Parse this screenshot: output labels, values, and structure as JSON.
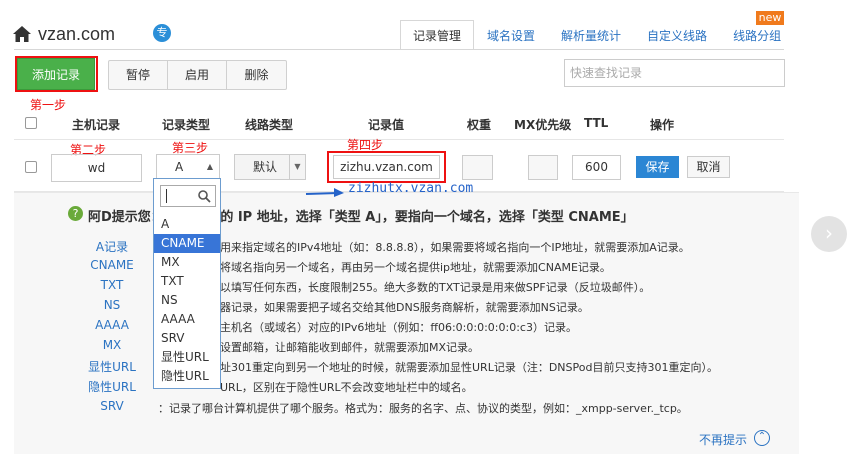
{
  "header": {
    "domain": "vzan.com",
    "badge": "专"
  },
  "tabs": [
    {
      "label": "记录管理",
      "active": true
    },
    {
      "label": "域名设置"
    },
    {
      "label": "解析量统计"
    },
    {
      "label": "自定义线路"
    },
    {
      "label": "线路分组"
    }
  ],
  "new_badge": "new",
  "toolbar": {
    "add_label": "添加记录",
    "pause_label": "暂停",
    "enable_label": "启用",
    "delete_label": "删除",
    "search_placeholder": "快速查找记录"
  },
  "steps": {
    "step1": "第一步",
    "step2": "第二步",
    "step3": "第三步",
    "step4": "第四步"
  },
  "columns": {
    "host": "主机记录",
    "type": "记录类型",
    "line": "线路类型",
    "value": "记录值",
    "weight": "权重",
    "mx": "MX优先级",
    "ttl": "TTL",
    "ops": "操作"
  },
  "row": {
    "host": "wd",
    "type": "A",
    "line": "默认",
    "value": "zizhu.vzan.com",
    "ttl": "600",
    "save": "保存",
    "cancel": "取消"
  },
  "dropdown": {
    "options": [
      "A",
      "CNAME",
      "MX",
      "TXT",
      "NS",
      "AAAA",
      "SRV",
      "显性URL",
      "隐性URL"
    ],
    "selected": "CNAME"
  },
  "annotation": "zizhutx.vzan.com",
  "tips": {
    "title": "阿D提示您：  间商提供的 IP 地址，选择「类型 A」，要指向一个域名，选择「类型 CNAME」",
    "items": [
      {
        "label": "A记录",
        "text": "用来指定域名的IPv4地址（如：8.8.8.8），如果需要将域名指向一个IP地址，就需要添加A记录。"
      },
      {
        "label": "CNAME",
        "text": "将域名指向另一个域名，再由另一个域名提供ip地址，就需要添加CNAME记录。"
      },
      {
        "label": "TXT",
        "text": "以填写任何东西，长度限制255。绝大多数的TXT记录是用来做SPF记录（反垃圾邮件）。"
      },
      {
        "label": "NS",
        "text": "器记录，如果需要把子域名交给其他DNS服务商解析，就需要添加NS记录。"
      },
      {
        "label": "AAAA",
        "text": "主机名（或域名）对应的IPv6地址（例如：ff06:0:0:0:0:0:0:c3）记录。"
      },
      {
        "label": "MX",
        "text": "设置邮箱，让邮箱能收到邮件，就需要添加MX记录。"
      },
      {
        "label": "显性URL",
        "text": "址301重定向到另一个地址的时候，就需要添加显性URL记录（注：DNSPod目前只支持301重定向）。"
      },
      {
        "label": "隐性URL",
        "text": "URL，区别在于隐性URL不会改变地址栏中的域名。"
      },
      {
        "label": "SRV",
        "text": "：记录了哪台计算机提供了哪个服务。格式为：服务的名字、点、协议的类型，例如：_xmpp-server._tcp。"
      }
    ],
    "dismiss": "不再提示"
  }
}
